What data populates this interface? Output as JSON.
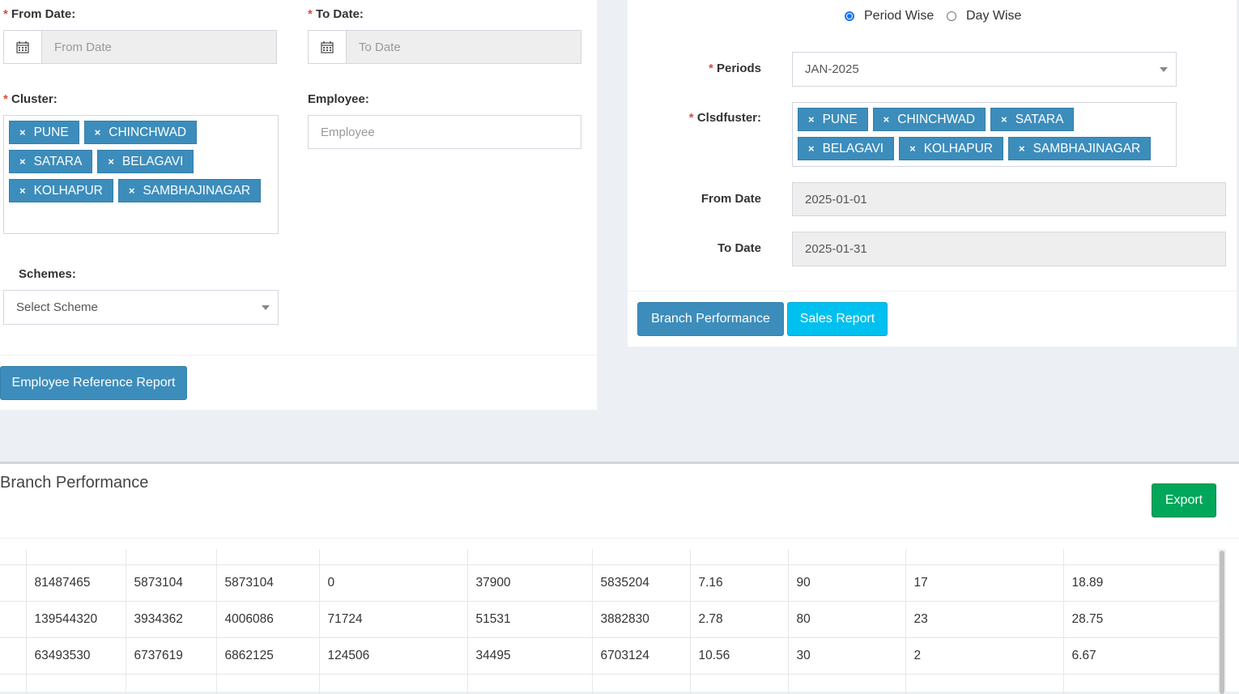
{
  "left_form": {
    "from_date": {
      "label": "From Date:",
      "placeholder": "From Date"
    },
    "to_date": {
      "label": "To Date:",
      "placeholder": "To Date"
    },
    "cluster": {
      "label": "Cluster:",
      "tags": [
        "PUNE",
        "CHINCHWAD",
        "SATARA",
        "BELAGAVI",
        "KOLHAPUR",
        "SAMBHAJINAGAR"
      ]
    },
    "employee": {
      "label": "Employee:",
      "placeholder": "Employee"
    },
    "schemes": {
      "label": "Schemes:",
      "selected": "Select Scheme"
    },
    "report_button": "Employee Reference Report"
  },
  "right_form": {
    "mode": {
      "period_wise": "Period Wise",
      "day_wise": "Day Wise",
      "selected": "Period Wise"
    },
    "periods": {
      "label": "Periods",
      "selected": "JAN-2025"
    },
    "cluster": {
      "label": "Clsdfuster:",
      "tags": [
        "PUNE",
        "CHINCHWAD",
        "SATARA",
        "BELAGAVI",
        "KOLHAPUR",
        "SAMBHAJINAGAR"
      ]
    },
    "from_date": {
      "label": "From Date",
      "value": "2025-01-01"
    },
    "to_date": {
      "label": "To Date",
      "value": "2025-01-31"
    },
    "branch_performance_button": "Branch Performance",
    "sales_report_button": "Sales Report"
  },
  "results": {
    "title": "Branch Performance",
    "export_button": "Export",
    "rows": [
      [
        "",
        "81487465",
        "5873104",
        "5873104",
        "0",
        "37900",
        "5835204",
        "7.16",
        "90",
        "17",
        "18.89"
      ],
      [
        "",
        "139544320",
        "3934362",
        "4006086",
        "71724",
        "51531",
        "3882830",
        "2.78",
        "80",
        "23",
        "28.75"
      ],
      [
        "",
        "63493530",
        "6737619",
        "6862125",
        "124506",
        "34495",
        "6703124",
        "10.56",
        "30",
        "2",
        "6.67"
      ]
    ]
  }
}
